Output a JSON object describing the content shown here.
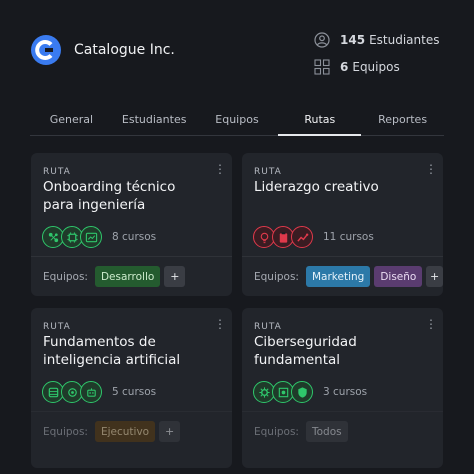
{
  "company": {
    "name": "Catalogue Inc."
  },
  "stats": {
    "students_count": "145",
    "students_label": "Estudiantes",
    "teams_count": "6",
    "teams_label": "Equipos"
  },
  "tabs": [
    "General",
    "Estudiantes",
    "Equipos",
    "Rutas",
    "Reportes"
  ],
  "active_tab": "Rutas",
  "menu_glyph": "⋮",
  "teams_label": "Equipos:",
  "plus_label": "+",
  "cards": [
    {
      "kind": "RUTA",
      "title": "Onboarding técnico para ingeniería",
      "courses": "8 cursos",
      "icon_color": "#2fc66b",
      "icons": [
        "network-icon",
        "cpu-icon",
        "dashboard-icon"
      ],
      "teams": [
        {
          "label": "Desarrollo",
          "bg": "#245b2f",
          "fg": "#cdeccd"
        }
      ],
      "show_plus": true
    },
    {
      "kind": "RUTA",
      "title": "Liderazgo creativo",
      "courses": "11 cursos",
      "icon_color": "#e0394b",
      "icons": [
        "bulb-icon",
        "clipboard-icon",
        "chart-icon"
      ],
      "teams": [
        {
          "label": "Marketing",
          "bg": "#2c79a8",
          "fg": "#e6f2fa"
        },
        {
          "label": "Diseño",
          "bg": "#5a3c70",
          "fg": "#eadcf3"
        }
      ],
      "show_plus": true
    },
    {
      "kind": "RUTA",
      "title": "Fundamentos de inteligencia artificial",
      "courses": "5 cursos",
      "icon_color": "#2fc66b",
      "icons": [
        "database-icon",
        "chip-icon",
        "robot-icon"
      ],
      "teams": [
        {
          "label": "Ejecutivo",
          "bg": "#5c3e12",
          "fg": "#f0d7a8"
        }
      ],
      "show_plus": true
    },
    {
      "kind": "RUTA",
      "title": "Ciberseguridad fundamental",
      "courses": "3 cursos",
      "icon_color": "#2fc66b",
      "icons": [
        "gear-icon",
        "target-icon",
        "shield-icon"
      ],
      "teams": [
        {
          "label": "Todos",
          "bg": "#3a3d44",
          "fg": "#d5d8de"
        }
      ],
      "show_plus": false
    }
  ],
  "colors": {
    "background": "#17191e",
    "card": "#22252b",
    "logo": "#3a7bf0"
  }
}
